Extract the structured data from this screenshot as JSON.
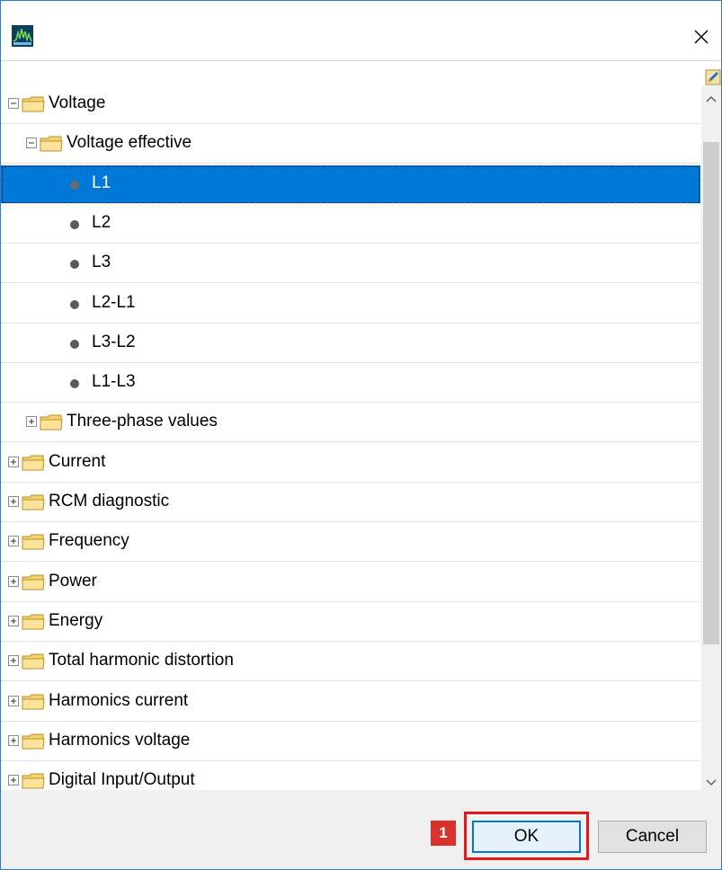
{
  "dialog": {
    "icon": "app-logo-icon",
    "close_icon": "close-icon"
  },
  "tree": {
    "items": [
      {
        "label": "Voltage",
        "level": 0,
        "type": "folder",
        "state": "expanded"
      },
      {
        "label": "Voltage effective",
        "level": 1,
        "type": "folder",
        "state": "expanded"
      },
      {
        "label": "L1",
        "level": 2,
        "type": "leaf",
        "selected": true
      },
      {
        "label": "L2",
        "level": 2,
        "type": "leaf"
      },
      {
        "label": "L3",
        "level": 2,
        "type": "leaf"
      },
      {
        "label": "L2-L1",
        "level": 2,
        "type": "leaf"
      },
      {
        "label": "L3-L2",
        "level": 2,
        "type": "leaf"
      },
      {
        "label": "L1-L3",
        "level": 2,
        "type": "leaf"
      },
      {
        "label": "Three-phase values",
        "level": 1,
        "type": "folder",
        "state": "collapsed"
      },
      {
        "label": "Current",
        "level": 0,
        "type": "folder",
        "state": "collapsed"
      },
      {
        "label": "RCM diagnostic",
        "level": 0,
        "type": "folder",
        "state": "collapsed"
      },
      {
        "label": "Frequency",
        "level": 0,
        "type": "folder",
        "state": "collapsed"
      },
      {
        "label": "Power",
        "level": 0,
        "type": "folder",
        "state": "collapsed"
      },
      {
        "label": "Energy",
        "level": 0,
        "type": "folder",
        "state": "collapsed"
      },
      {
        "label": "Total harmonic distortion",
        "level": 0,
        "type": "folder",
        "state": "collapsed"
      },
      {
        "label": "Harmonics current",
        "level": 0,
        "type": "folder",
        "state": "collapsed"
      },
      {
        "label": "Harmonics voltage",
        "level": 0,
        "type": "folder",
        "state": "collapsed"
      },
      {
        "label": "Digital Input/Output",
        "level": 0,
        "type": "folder",
        "state": "collapsed"
      }
    ]
  },
  "footer": {
    "step_number": "1",
    "ok_label": "OK",
    "cancel_label": "Cancel"
  },
  "colors": {
    "selection": "#0078d7",
    "highlight_red": "#e0191f",
    "badge_red": "#d9312d",
    "folder_yellow": "#f5d26b"
  }
}
